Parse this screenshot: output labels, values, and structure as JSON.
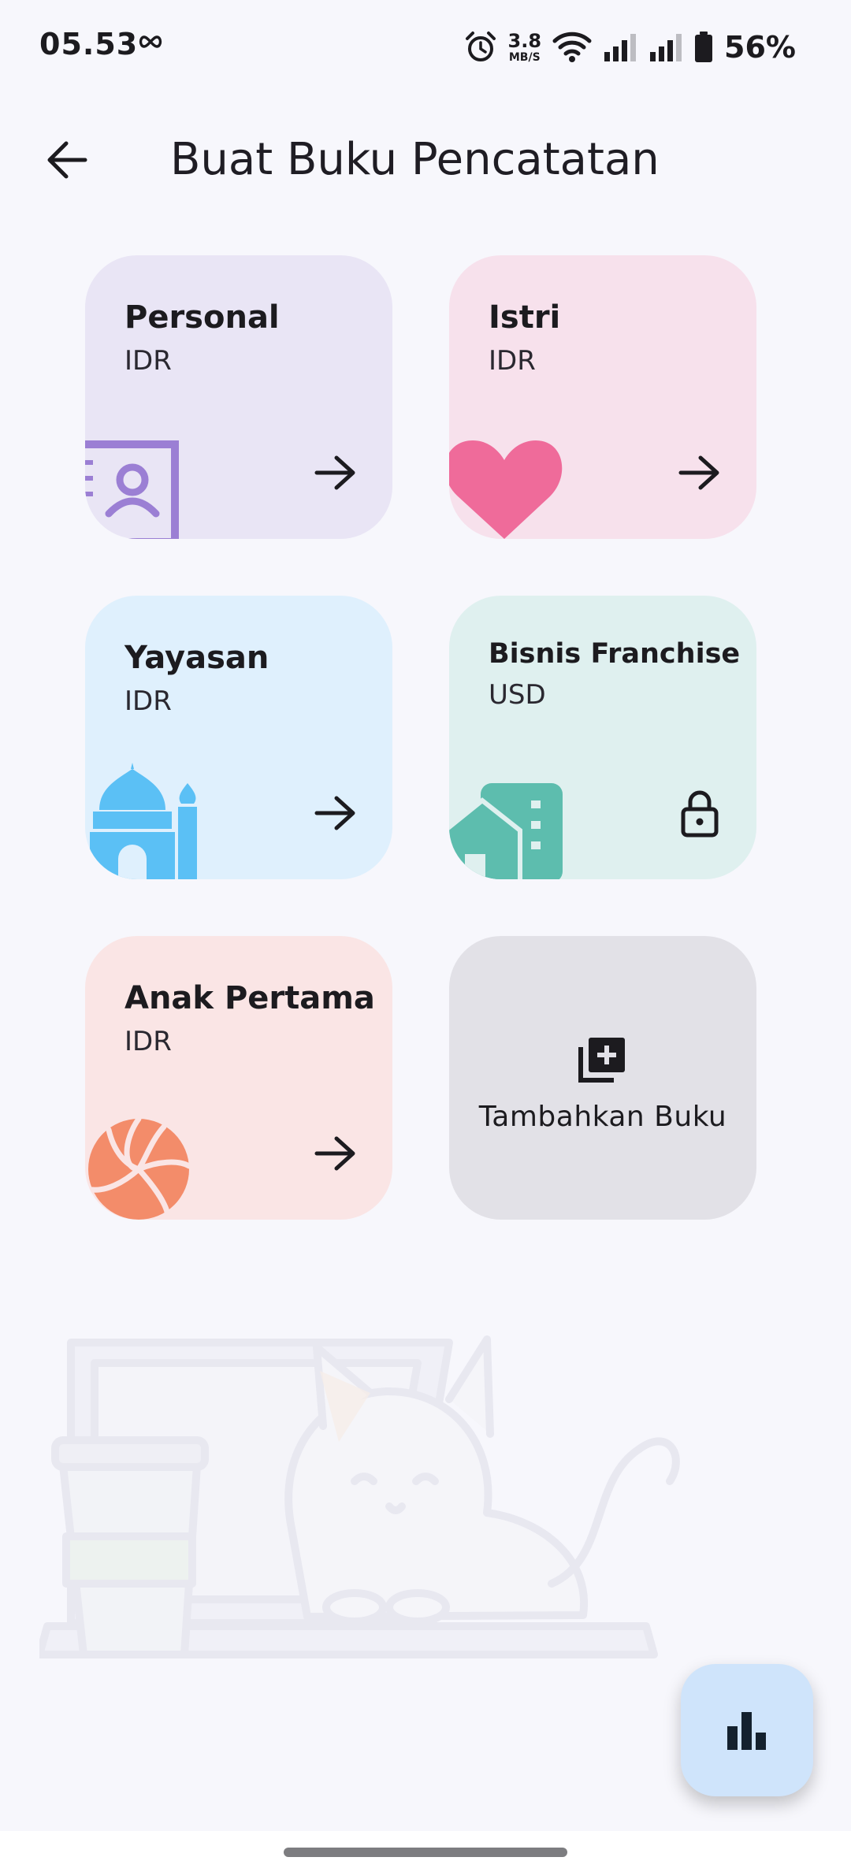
{
  "status_bar": {
    "time": "05.53",
    "net_speed_value": "3.8",
    "net_speed_unit": "MB/S",
    "battery": "56%"
  },
  "header": {
    "title": "Buat Buku Pencatatan"
  },
  "books": [
    {
      "name": "Personal",
      "currency": "IDR",
      "icon": "contact-book-icon",
      "bg": "#e9e5f5",
      "accent": "#9b7fd4",
      "locked": false
    },
    {
      "name": "Istri",
      "currency": "IDR",
      "icon": "heart-icon",
      "bg": "#f7e1ec",
      "accent": "#ef6b9a",
      "locked": false
    },
    {
      "name": "Yayasan",
      "currency": "IDR",
      "icon": "mosque-icon",
      "bg": "#dff0fd",
      "accent": "#5bc0f5",
      "locked": false
    },
    {
      "name": "Bisnis Franchise",
      "currency": "USD",
      "icon": "building-icon",
      "bg": "#dff0ef",
      "accent": "#5dbdae",
      "locked": true
    },
    {
      "name": "Anak Pertama",
      "currency": "IDR",
      "icon": "volleyball-icon",
      "bg": "#fae5e5",
      "accent": "#f38c6a",
      "locked": false
    }
  ],
  "add_book": {
    "label": "Tambahkan Buku"
  },
  "fab": {
    "icon": "bar-chart-icon",
    "color": "#cfe4fb"
  }
}
